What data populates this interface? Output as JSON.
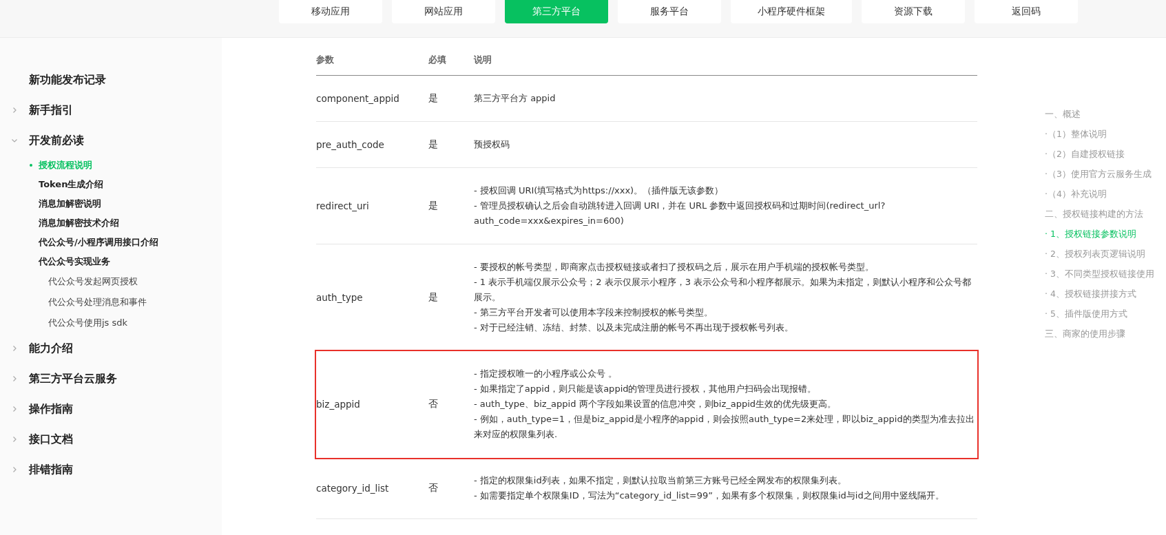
{
  "top_nav": [
    {
      "label": "移动应用",
      "selected": false
    },
    {
      "label": "网站应用",
      "selected": false
    },
    {
      "label": "第三方平台",
      "selected": true
    },
    {
      "label": "服务平台",
      "selected": false
    },
    {
      "label": "小程序硬件框架",
      "selected": false
    },
    {
      "label": "资源下载",
      "selected": false
    },
    {
      "label": "返回码",
      "selected": false
    }
  ],
  "sidebar": {
    "items": [
      {
        "label": "新功能发布记录",
        "kind": "leaf"
      },
      {
        "label": "新手指引",
        "kind": "group",
        "expanded": false
      },
      {
        "label": "开发前必读",
        "kind": "group",
        "expanded": true,
        "children": [
          {
            "label": "授权流程说明",
            "selected": true
          },
          {
            "label": "Token生成介绍",
            "selected": false
          },
          {
            "label": "消息加解密说明",
            "selected": false
          },
          {
            "label": "消息加解密技术介绍",
            "selected": false
          },
          {
            "label": "代公众号/小程序调用接口介绍",
            "selected": false
          },
          {
            "label": "代公众号实现业务",
            "selected": false,
            "children": [
              {
                "label": "代公众号发起网页授权",
                "selected": false
              },
              {
                "label": "代公众号处理消息和事件",
                "selected": false
              },
              {
                "label": "代公众号使用js sdk",
                "selected": false
              }
            ]
          }
        ]
      },
      {
        "label": "能力介绍",
        "kind": "group",
        "expanded": false
      },
      {
        "label": "第三方平台云服务",
        "kind": "group",
        "expanded": false
      },
      {
        "label": "操作指南",
        "kind": "group",
        "expanded": false
      },
      {
        "label": "接口文档",
        "kind": "group",
        "expanded": false
      },
      {
        "label": "排错指南",
        "kind": "group",
        "expanded": false
      }
    ]
  },
  "table": {
    "columns": [
      "参数",
      "必填",
      "说明"
    ],
    "rows": [
      {
        "param": "component_appid",
        "required": "是",
        "description": [
          "第三方平台方 appid"
        ],
        "highlighted": false
      },
      {
        "param": "pre_auth_code",
        "required": "是",
        "description": [
          "预授权码"
        ],
        "highlighted": false
      },
      {
        "param": "redirect_uri",
        "required": "是",
        "description": [
          "- 授权回调 URI(填写格式为https://xxx)。（插件版无该参数）",
          "- 管理员授权确认之后会自动跳转进入回调 URI，并在 URL 参数中返回授权码和过期时间(redirect_url?auth_code=xxx&expires_in=600)"
        ],
        "highlighted": false
      },
      {
        "param": "auth_type",
        "required": "是",
        "description": [
          "- 要授权的帐号类型，即商家点击授权链接或者扫了授权码之后，展示在用户手机端的授权帐号类型。",
          "- 1 表示手机端仅展示公众号；2 表示仅展示小程序，3 表示公众号和小程序都展示。如果为未指定，则默认小程序和公众号都展示。",
          "- 第三方平台开发者可以使用本字段来控制授权的帐号类型。",
          "- 对于已经注销、冻结、封禁、以及未完成注册的帐号不再出现于授权帐号列表。"
        ],
        "highlighted": false
      },
      {
        "param": "biz_appid",
        "required": "否",
        "description": [
          "- 指定授权唯一的小程序或公众号 。",
          "- 如果指定了appid，则只能是该appid的管理员进行授权，其他用户扫码会出现报错。",
          "- auth_type、biz_appid 两个字段如果设置的信息冲突，则biz_appid生效的优先级更高。",
          "- 例如，auth_type=1，但是biz_appid是小程序的appid，则会按照auth_type=2来处理，即以biz_appid的类型为准去拉出来对应的权限集列表."
        ],
        "highlighted": true
      },
      {
        "param": "category_id_list",
        "required": "否",
        "description": [
          "- 指定的权限集id列表，如果不指定，则默认拉取当前第三方账号已经全网发布的权限集列表。",
          "- 如需要指定单个权限集ID，写法为“category_id_list=99”，如果有多个权限集，则权限集id与id之间用中竖线隔开。"
        ],
        "highlighted": false
      }
    ]
  },
  "toc": [
    {
      "label": "一、概述",
      "selected": false
    },
    {
      "label": "·（1）整体说明",
      "selected": false
    },
    {
      "label": "·（2）自建授权链接",
      "selected": false
    },
    {
      "label": "·（3）使用官方云服务生成",
      "selected": false
    },
    {
      "label": "·（4）补充说明",
      "selected": false
    },
    {
      "label": "二、授权链接构建的方法",
      "selected": false
    },
    {
      "label": "· 1、授权链接参数说明",
      "selected": true
    },
    {
      "label": "· 2、授权列表页逻辑说明",
      "selected": false
    },
    {
      "label": "· 3、不同类型授权链接使用",
      "selected": false
    },
    {
      "label": "· 4、授权链接拼接方式",
      "selected": false
    },
    {
      "label": "· 5、插件版使用方式",
      "selected": false
    },
    {
      "label": "三、商家的使用步骤",
      "selected": false
    }
  ]
}
